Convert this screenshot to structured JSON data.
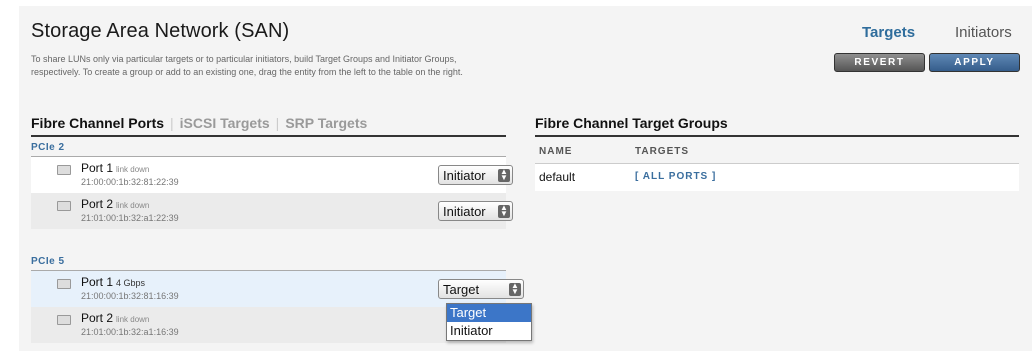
{
  "header": {
    "title": "Storage Area Network (SAN)",
    "tab_targets": "Targets",
    "tab_initiators": "Initiators",
    "description_line1": "To share LUNs only via particular targets or to particular initiators, build Target Groups and Initiator Groups,",
    "description_line2": "respectively. To create a group or add to an existing one, drag the entity from the left to the table on the right."
  },
  "buttons": {
    "revert": "REVERT",
    "apply": "APPLY"
  },
  "left": {
    "tabs": [
      "Fibre Channel Ports",
      "iSCSI Targets",
      "SRP Targets"
    ],
    "groups": [
      {
        "label": "PCIe 2",
        "ports": [
          {
            "name": "Port 1",
            "status": "link down",
            "wwn": "21:00:00:1b:32:81:22:39",
            "mode": "Initiator"
          },
          {
            "name": "Port 2",
            "status": "link down",
            "wwn": "21:01:00:1b:32:a1:22:39",
            "mode": "Initiator"
          }
        ]
      },
      {
        "label": "PCIe 5",
        "ports": [
          {
            "name": "Port 1",
            "status": "4 Gbps",
            "wwn": "21:00:00:1b:32:81:16:39",
            "mode": "Target"
          },
          {
            "name": "Port 2",
            "status": "link down",
            "wwn": "21:01:00:1b:32:a1:16:39",
            "mode": ""
          }
        ]
      }
    ],
    "dropdown_options": [
      "Target",
      "Initiator"
    ]
  },
  "right": {
    "heading": "Fibre Channel Target Groups",
    "col_name": "NAME",
    "col_targets": "TARGETS",
    "rows": [
      {
        "name": "default",
        "targets": "[ ALL PORTS ]"
      }
    ]
  }
}
